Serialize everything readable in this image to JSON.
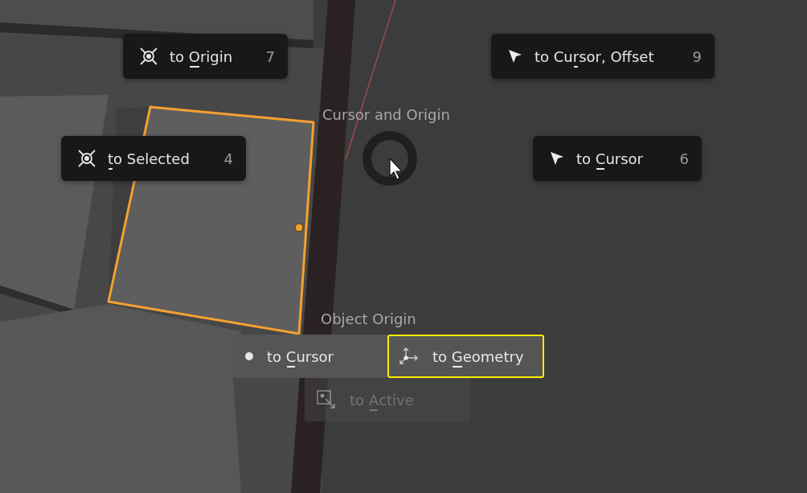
{
  "pie": {
    "title": "Cursor and Origin",
    "items": [
      {
        "before": "to ",
        "key": "O",
        "after": "rigin",
        "shortcut": "7"
      },
      {
        "before": "to Cu",
        "key": "r",
        "after": "sor, Offset",
        "shortcut": "9"
      },
      {
        "key": "t",
        "after": "o Selected",
        "shortcut": "4"
      },
      {
        "before": "to ",
        "key": "C",
        "after": "ursor",
        "shortcut": "6"
      }
    ]
  },
  "object_origin": {
    "title": "Object Origin",
    "items": [
      {
        "before": "to ",
        "key": "C",
        "after": "ursor",
        "highlighted": false,
        "disabled": false
      },
      {
        "before": "to ",
        "key": "G",
        "after": "eometry",
        "highlighted": true,
        "disabled": false
      },
      {
        "before": "to ",
        "key": "A",
        "after": "ctive",
        "highlighted": false,
        "disabled": true
      }
    ]
  }
}
